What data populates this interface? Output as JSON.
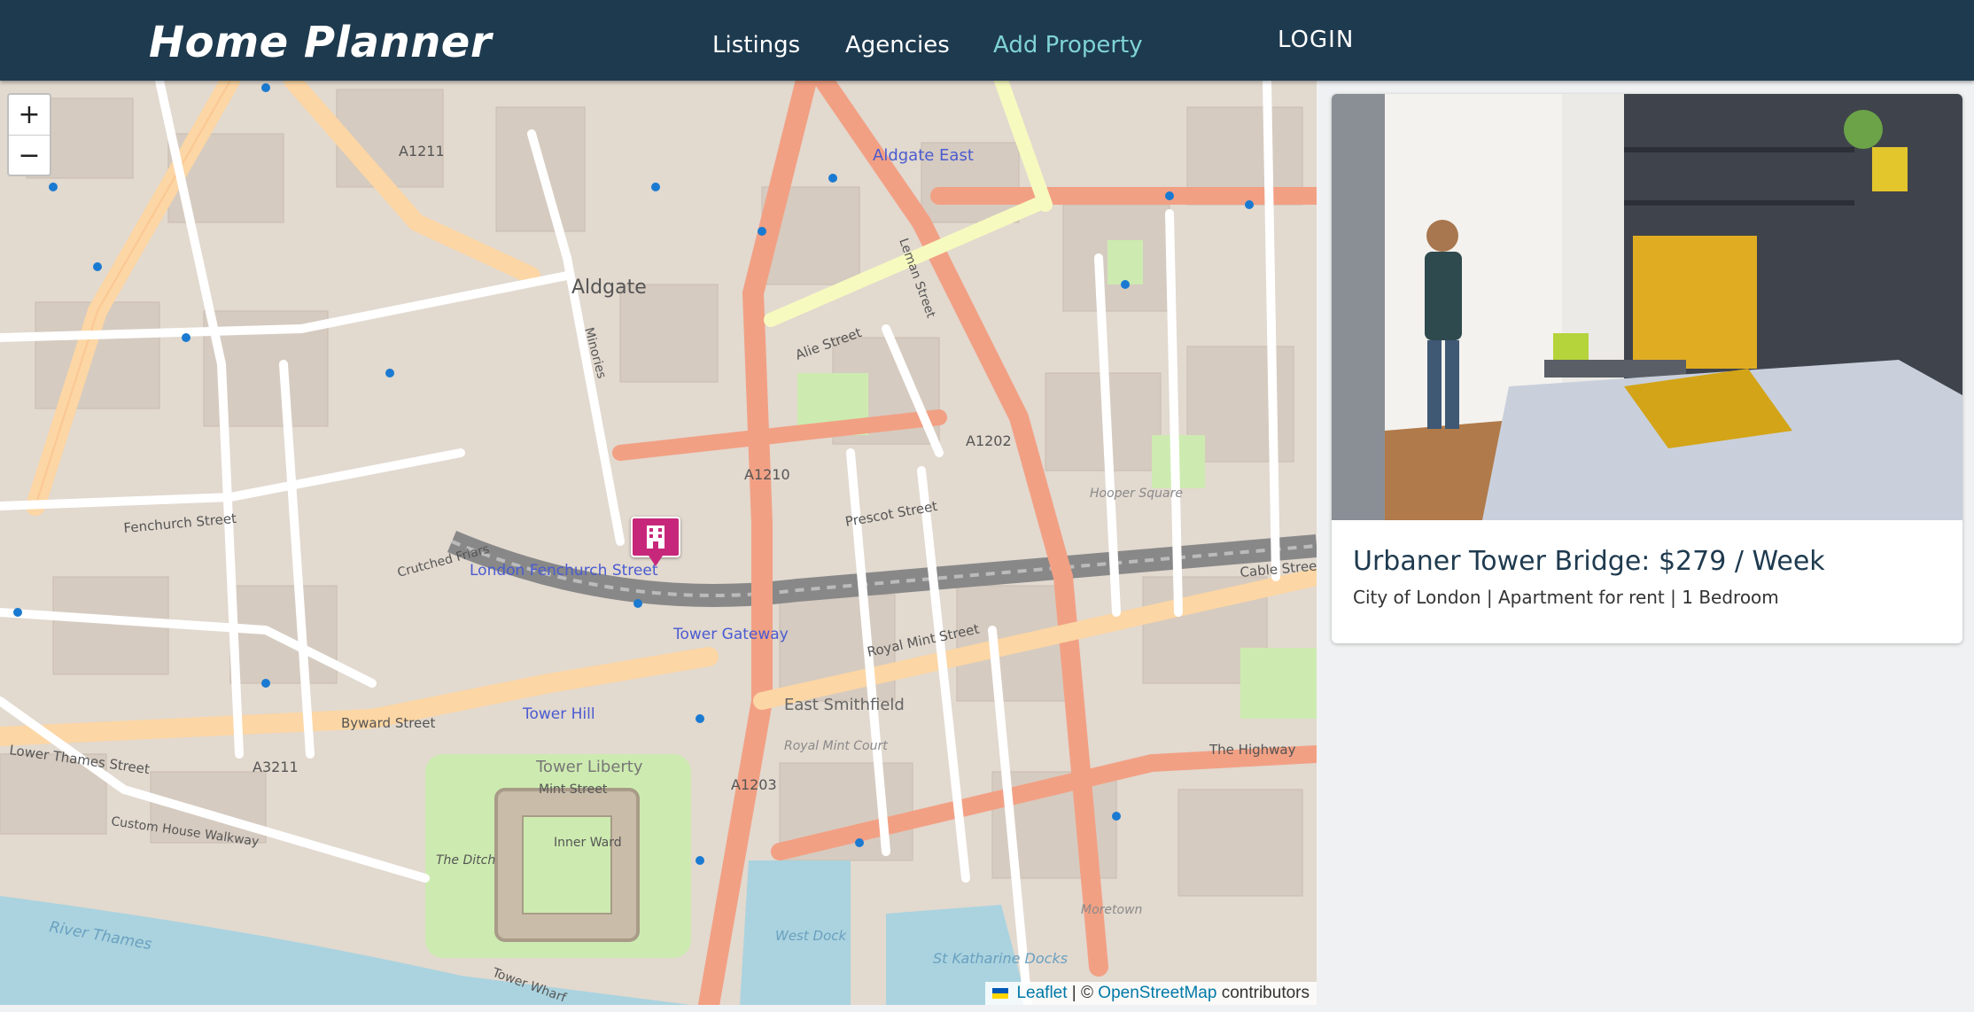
{
  "header": {
    "brand": "Home Planner",
    "nav": [
      {
        "label": "Listings"
      },
      {
        "label": "Agencies"
      },
      {
        "label": "Add Property"
      }
    ],
    "login": "LOGIN",
    "colors": {
      "background": "#1e3a4f",
      "accent": "#7fd3d6"
    }
  },
  "map": {
    "zoom_in": "+",
    "zoom_out": "−",
    "attribution": {
      "leaflet": "Leaflet",
      "separator": "| ©",
      "osm": "OpenStreetMap",
      "suffix": "contributors"
    },
    "marker_icon": "building-icon",
    "labels": {
      "aldgate": "Aldgate",
      "aldgate_east": "Aldgate East",
      "fenchurch": "London Fenchurch Street",
      "tower_gateway": "Tower Gateway",
      "tower_hill": "Tower Hill",
      "tower_liberty": "Tower Liberty",
      "east_smithfield": "East Smithfield",
      "royal_mint_street": "Royal Mint Street",
      "prescot_street": "Prescot Street",
      "alie_street": "Alie Street",
      "byward_street": "Byward Street",
      "lower_thames_street": "Lower Thames Street",
      "fenchurch_street": "Fenchurch Street",
      "the_highway": "The Highway",
      "cable_street": "Cable Street",
      "a1211": "A1211",
      "a1210": "A1210",
      "a1202": "A1202",
      "a1203": "A1203",
      "a3211": "A3211",
      "river_thames": "River Thames",
      "west_dock": "West Dock",
      "st_katharine": "St Katharine Docks",
      "mint_street": "Mint Street",
      "inner_ward": "Inner Ward",
      "the_ditch": "The Ditch",
      "hooper_square": "Hooper Square",
      "moretown": "Moretown",
      "royal_mint_court": "Royal Mint Court",
      "crutched_friars": "Crutched Friars",
      "minories": "Minories",
      "tower_wharf": "Tower Wharf",
      "custom_house": "Custom House Walkway",
      "leman_street": "Leman Street"
    }
  },
  "listing": {
    "title": "Urbaner Tower Bridge: $279 / Week",
    "subtitle": "City of London | Apartment for rent | 1 Bedroom"
  }
}
